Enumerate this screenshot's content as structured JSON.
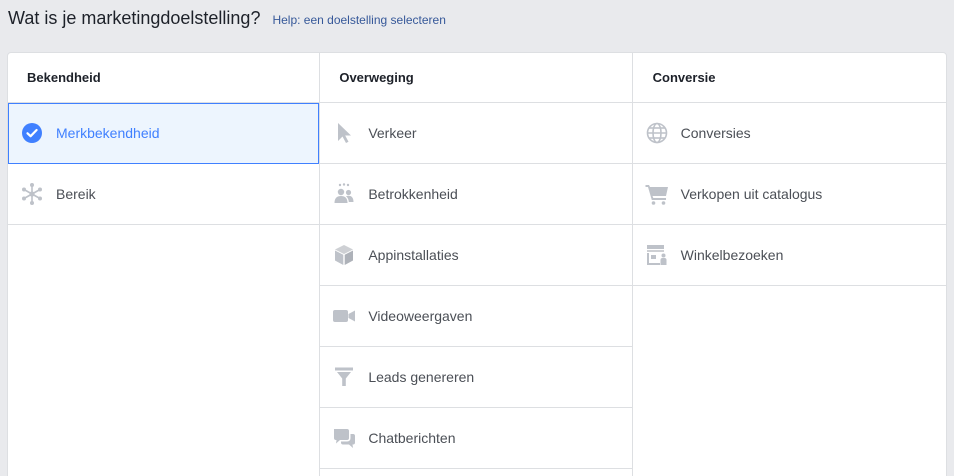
{
  "header": {
    "title": "Wat is je marketingdoelstelling?",
    "help_link": "Help: een doelstelling selecteren"
  },
  "columns": [
    {
      "title": "Bekendheid",
      "items": [
        {
          "label": "Merkbekendheid",
          "icon": "check-circle-icon",
          "selected": true
        },
        {
          "label": "Bereik",
          "icon": "reach-icon",
          "selected": false
        }
      ]
    },
    {
      "title": "Overweging",
      "items": [
        {
          "label": "Verkeer",
          "icon": "cursor-icon"
        },
        {
          "label": "Betrokkenheid",
          "icon": "people-icon"
        },
        {
          "label": "Appinstallaties",
          "icon": "box-icon"
        },
        {
          "label": "Videoweergaven",
          "icon": "video-camera-icon"
        },
        {
          "label": "Leads genereren",
          "icon": "funnel-icon"
        },
        {
          "label": "Chatberichten",
          "icon": "chat-bubbles-icon"
        }
      ]
    },
    {
      "title": "Conversie",
      "items": [
        {
          "label": "Conversies",
          "icon": "globe-icon"
        },
        {
          "label": "Verkopen uit catalogus",
          "icon": "shopping-cart-icon"
        },
        {
          "label": "Winkelbezoeken",
          "icon": "store-icon"
        }
      ]
    }
  ],
  "colors": {
    "accent": "#4080ff",
    "selected_bg": "#edf5fe",
    "icon_gray": "#bec2c9",
    "link": "#365899"
  }
}
